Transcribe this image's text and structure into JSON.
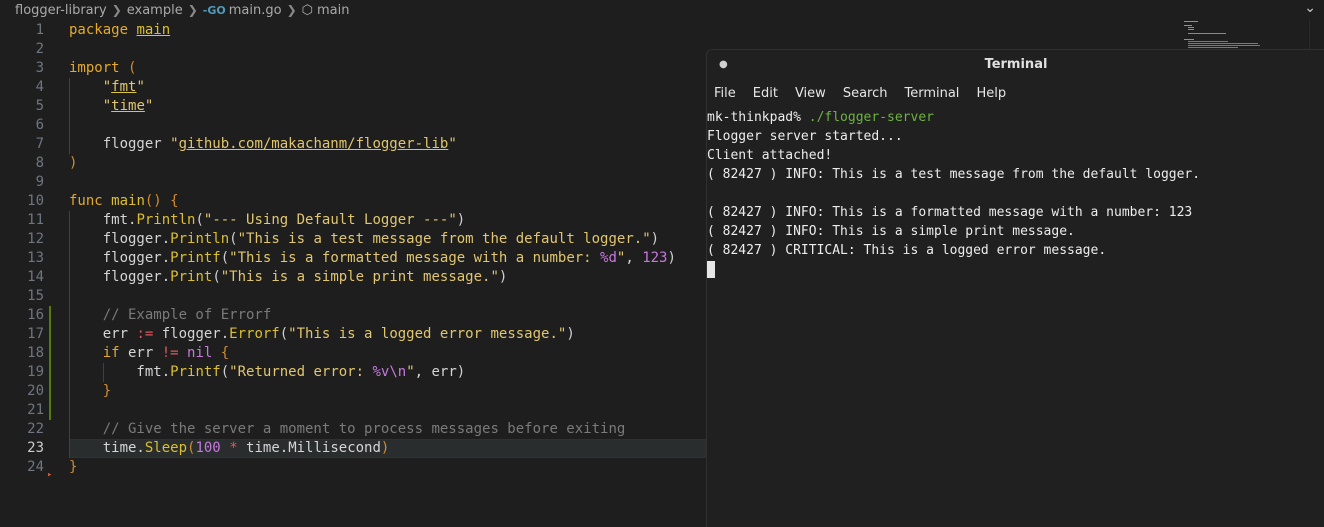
{
  "breadcrumb": {
    "folder": "flogger-library",
    "subfolder": "example",
    "file_icon": "go-file-icon",
    "go_badge": "-GO",
    "file": "main.go",
    "symbol_icon": "cube-icon",
    "symbol": "main"
  },
  "editor": {
    "line_numbers": [
      "1",
      "2",
      "3",
      "4",
      "5",
      "6",
      "7",
      "8",
      "9",
      "10",
      "11",
      "12",
      "13",
      "14",
      "15",
      "16",
      "17",
      "18",
      "19",
      "20",
      "21",
      "22",
      "23",
      "24"
    ],
    "current_line": "23"
  },
  "terminal": {
    "title": "Terminal",
    "menu": [
      "File",
      "Edit",
      "View",
      "Search",
      "Terminal",
      "Help"
    ],
    "prompt": "mk-thinkpad% ",
    "command": "./flogger-server",
    "output": [
      "Flogger server started...",
      "Client attached!",
      "( 82427 ) INFO: This is a test message from the default logger.",
      "",
      "( 82427 ) INFO: This is a formatted message with a number: 123",
      "( 82427 ) INFO: This is a simple print message.",
      "( 82427 ) CRITICAL: This is a logged error message."
    ]
  },
  "colors": {
    "keyword": "#e5a92e",
    "string": "#e1c66f",
    "function": "#dcbf2d",
    "comment": "#7a7a7a",
    "operator": "#e05561",
    "number": "#c678dd",
    "prompt_command": "#6db33f"
  }
}
